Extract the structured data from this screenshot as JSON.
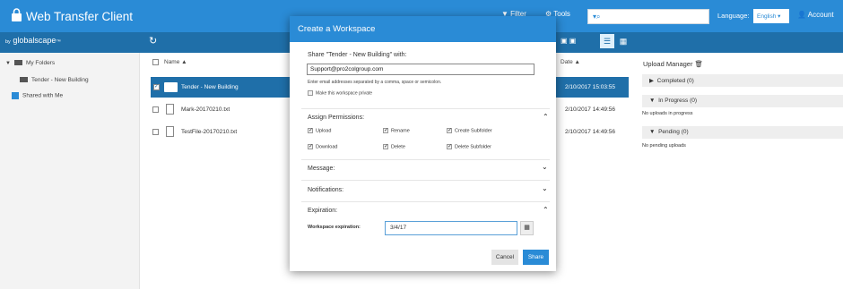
{
  "header": {
    "title": "Web Transfer Client",
    "filter_label": "Filter",
    "tools_label": "Tools",
    "language_label": "Language:",
    "language_value": "English",
    "account_label": "Account"
  },
  "subbar": {
    "logo_prefix": "by",
    "logo": "globalscape",
    "logo_suffix": "™"
  },
  "sidebar": {
    "items": [
      {
        "label": "My Folders"
      },
      {
        "label": "Tender - New Building"
      },
      {
        "label": "Shared with Me"
      }
    ]
  },
  "filelist": {
    "name_header": "Name",
    "date_header": "Date",
    "rows": [
      {
        "name": "Tender - New Building",
        "date": "2/10/2017 15:03:55"
      },
      {
        "name": "Mark-20170210.txt",
        "date": "2/10/2017 14:49:56"
      },
      {
        "name": "TestFile-20170210.txt",
        "date": "2/10/2017 14:49:56"
      }
    ]
  },
  "upload": {
    "title": "Upload Manager",
    "completed": "Completed (0)",
    "in_progress": "In Progress (0)",
    "in_progress_empty": "No uploads in progress",
    "pending": "Pending (0)",
    "pending_empty": "No pending uploads"
  },
  "modal": {
    "title": "Create a Workspace",
    "share_with_label": "Share \"Tender - New Building\" with:",
    "email_value": "Support@pro2colgroup.com",
    "email_hint": "Enter email addresses separated by a comma, space or semicolon.",
    "private_label": "Make this workspace private",
    "permissions_label": "Assign Permissions:",
    "permissions": {
      "upload": "Upload",
      "rename": "Rename",
      "create_subfolder": "Create Subfolder",
      "download": "Download",
      "delete": "Delete",
      "delete_subfolder": "Delete Subfolder"
    },
    "message_label": "Message:",
    "notifications_label": "Notifications:",
    "expiration_label": "Expiration:",
    "workspace_expiration_label": "Workspace expiration:",
    "workspace_expiration_value": "3/4/17",
    "cancel_label": "Cancel",
    "share_label": "Share"
  },
  "colors": {
    "header_blue": "#2a8bd6",
    "subbar_blue": "#1f6fa9",
    "selected_row": "#1f6fa9"
  }
}
